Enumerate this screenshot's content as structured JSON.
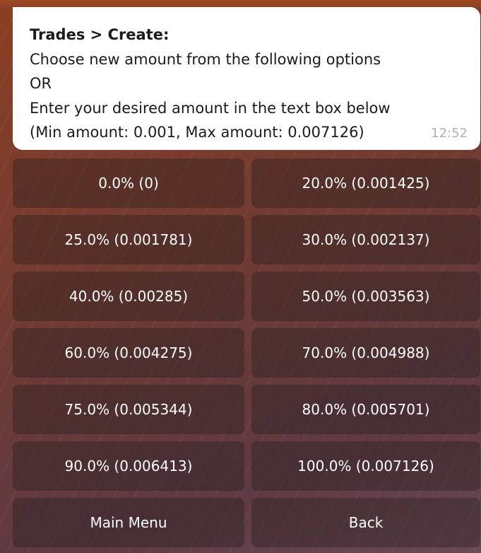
{
  "message": {
    "title": "Trades > Create:",
    "lines": [
      "Choose new amount from the following options",
      "OR",
      "Enter your desired amount in the text box below",
      "(Min amount:  0.001, Max amount: 0.007126)"
    ],
    "time": "12:52"
  },
  "keyboard": {
    "buttons": [
      "0.0% (0)",
      "20.0% (0.001425)",
      "25.0% (0.001781)",
      "30.0% (0.002137)",
      "40.0% (0.00285)",
      "50.0% (0.003563)",
      "60.0% (0.004275)",
      "70.0% (0.004988)",
      "75.0% (0.005344)",
      "80.0% (0.005701)",
      "90.0% (0.006413)",
      "100.0% (0.007126)",
      "Main Menu",
      "Back"
    ]
  }
}
